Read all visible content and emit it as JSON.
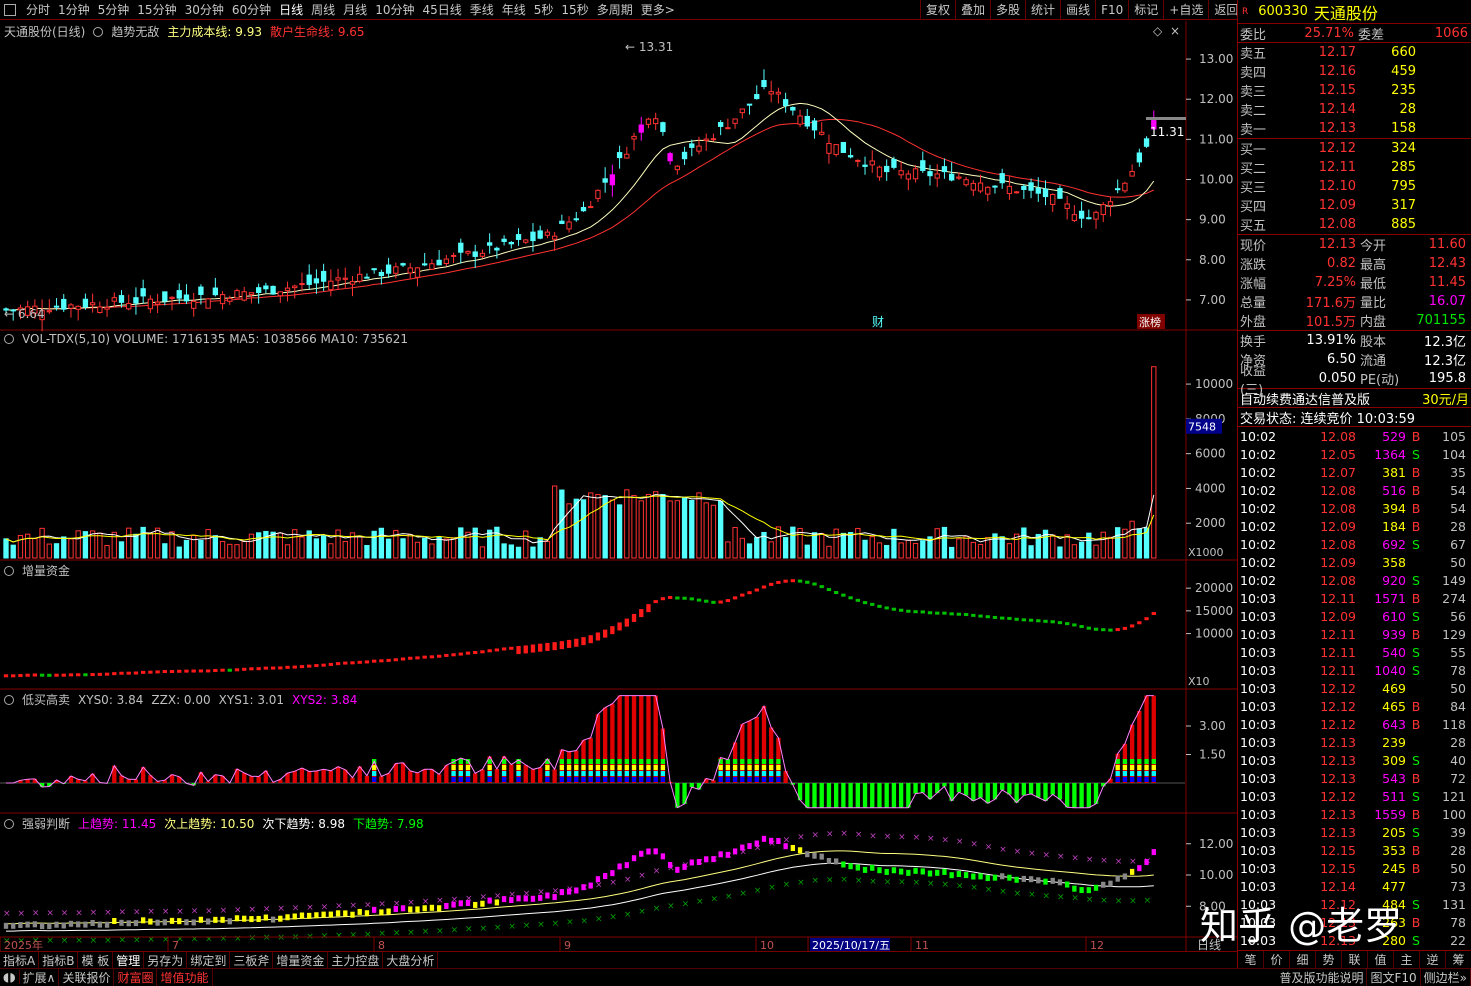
{
  "toolbar": {
    "periods": [
      "分时",
      "1分钟",
      "5分钟",
      "15分钟",
      "30分钟",
      "60分钟",
      "日线",
      "周线",
      "月线",
      "10分钟",
      "45日线",
      "季线",
      "年线",
      "5秒",
      "15秒",
      "多周期",
      "更多>"
    ],
    "active_period": "日线",
    "right_buttons": [
      "复权",
      "叠加",
      "多股",
      "统计",
      "画线",
      "F10",
      "标记",
      "+自选",
      "返回"
    ]
  },
  "main_panel": {
    "title": "天通股份(日线)",
    "indicator": "趋势无敌",
    "cost_label": "主力成本线: 9.93",
    "retail_label": "散户生命线: 9.65",
    "high_label": "13.31",
    "low_label": "6.64",
    "last_label": "11.31",
    "tag_cai": "财",
    "tag_zt": "涨榜",
    "y_ticks": [
      "13.00",
      "12.00",
      "11.00",
      "10.00",
      "9.00",
      "8.00",
      "7.00"
    ]
  },
  "vol_panel": {
    "title": "VOL-TDX(5,10) VOLUME: 1716135 MA5: 1038566 MA10: 735621",
    "y_ticks": [
      "10000",
      "8000",
      "6000",
      "4000",
      "2000"
    ],
    "unit": "X1000",
    "current_tag": "7548"
  },
  "zl_panel": {
    "title": "增量资金",
    "y_ticks": [
      "20000",
      "15000",
      "10000"
    ],
    "unit": "X10"
  },
  "dm_panel": {
    "title": "低买高卖",
    "xys0": "XYS0: 3.84",
    "zzx": "ZZX: 0.00",
    "xys1": "XYS1: 3.01",
    "xys2": "XYS2: 3.84",
    "y_ticks": [
      "3.00",
      "1.50"
    ]
  },
  "qr_panel": {
    "title": "强弱判断",
    "up": "上趋势: 11.45",
    "up2": "次上趋势: 10.50",
    "down2": "次下趋势: 8.98",
    "down": "下趋势: 7.98",
    "y_ticks": [
      "12.00",
      "10.00",
      "8.00"
    ]
  },
  "date_axis": [
    "2025年",
    "7",
    "8",
    "9",
    "10",
    "2025/10/17/五",
    "11",
    "12"
  ],
  "date_axis_right": "日线",
  "bottom_tabs1": [
    "指标A",
    "指标B",
    "模 板",
    "管理",
    "另存为",
    "绑定到",
    "三板斧",
    "增量资金",
    "主力控盘",
    "大盘分析"
  ],
  "bottom_tabs2": [
    "扩展∧",
    "关联报价",
    "财富圈",
    "增值功能"
  ],
  "bottom_right": [
    "普及版功能说明",
    "图文F10",
    "侧边栏»"
  ],
  "quote": {
    "code": "600330",
    "name": "天通股份",
    "weibi_label": "委比",
    "weibi": "25.71%",
    "weicha_label": "委差",
    "weicha": "1066",
    "asks": [
      {
        "label": "卖五",
        "price": "12.17",
        "vol": "660"
      },
      {
        "label": "卖四",
        "price": "12.16",
        "vol": "459"
      },
      {
        "label": "卖三",
        "price": "12.15",
        "vol": "235"
      },
      {
        "label": "卖二",
        "price": "12.14",
        "vol": "28"
      },
      {
        "label": "卖一",
        "price": "12.13",
        "vol": "158"
      }
    ],
    "bids": [
      {
        "label": "买一",
        "price": "12.12",
        "vol": "324"
      },
      {
        "label": "买二",
        "price": "12.11",
        "vol": "285"
      },
      {
        "label": "买三",
        "price": "12.10",
        "vol": "795"
      },
      {
        "label": "买四",
        "price": "12.09",
        "vol": "317"
      },
      {
        "label": "买五",
        "price": "12.08",
        "vol": "885"
      }
    ],
    "stats": [
      {
        "l1": "现价",
        "v1": "12.13",
        "l2": "今开",
        "v2": "11.60"
      },
      {
        "l1": "涨跌",
        "v1": "0.82",
        "l2": "最高",
        "v2": "12.43"
      },
      {
        "l1": "涨幅",
        "v1": "7.25%",
        "l2": "最低",
        "v2": "11.45"
      },
      {
        "l1": "总量",
        "v1": "171.6万",
        "l2": "量比",
        "v2": "16.07"
      },
      {
        "l1": "外盘",
        "v1": "101.5万",
        "l2": "内盘",
        "v2": "701155"
      }
    ],
    "stats2": [
      {
        "l1": "换手",
        "v1": "13.91%",
        "l2": "股本",
        "v2": "12.3亿"
      },
      {
        "l1": "净资",
        "v1": "6.50",
        "l2": "流通",
        "v2": "12.3亿"
      },
      {
        "l1": "收益(三)",
        "v1": "0.050",
        "l2": "PE(动)",
        "v2": "195.8"
      }
    ],
    "promo": "自动续费通达信普及版",
    "promo_price": "30元/月",
    "trade_status": "交易状态: 连续竞价 10:03:59",
    "ticks": [
      [
        "10:02",
        "12.08",
        "529",
        "B",
        "105"
      ],
      [
        "10:02",
        "12.05",
        "1364",
        "S",
        "104"
      ],
      [
        "10:02",
        "12.07",
        "381",
        "B",
        "35"
      ],
      [
        "10:02",
        "12.08",
        "516",
        "B",
        "54"
      ],
      [
        "10:02",
        "12.08",
        "394",
        "B",
        "54"
      ],
      [
        "10:02",
        "12.09",
        "184",
        "B",
        "28"
      ],
      [
        "10:02",
        "12.08",
        "692",
        "S",
        "67"
      ],
      [
        "10:02",
        "12.09",
        "358",
        "",
        "50"
      ],
      [
        "10:02",
        "12.08",
        "920",
        "S",
        "149"
      ],
      [
        "10:03",
        "12.11",
        "1571",
        "B",
        "274"
      ],
      [
        "10:03",
        "12.09",
        "610",
        "S",
        "56"
      ],
      [
        "10:03",
        "12.11",
        "939",
        "B",
        "129"
      ],
      [
        "10:03",
        "12.11",
        "540",
        "S",
        "55"
      ],
      [
        "10:03",
        "12.11",
        "1040",
        "S",
        "78"
      ],
      [
        "10:03",
        "12.12",
        "469",
        "",
        "50"
      ],
      [
        "10:03",
        "12.12",
        "465",
        "B",
        "84"
      ],
      [
        "10:03",
        "12.12",
        "643",
        "B",
        "118"
      ],
      [
        "10:03",
        "12.13",
        "239",
        "",
        "28"
      ],
      [
        "10:03",
        "12.13",
        "309",
        "S",
        "40"
      ],
      [
        "10:03",
        "12.13",
        "543",
        "B",
        "72"
      ],
      [
        "10:03",
        "12.12",
        "511",
        "S",
        "121"
      ],
      [
        "10:03",
        "12.13",
        "1559",
        "B",
        "100"
      ],
      [
        "10:03",
        "12.13",
        "205",
        "S",
        "39"
      ],
      [
        "10:03",
        "12.15",
        "353",
        "B",
        "28"
      ],
      [
        "10:03",
        "12.15",
        "245",
        "B",
        "50"
      ],
      [
        "10:03",
        "12.14",
        "477",
        "",
        "73"
      ],
      [
        "10:03",
        "12.12",
        "484",
        "S",
        "131"
      ],
      [
        "10:03",
        "12.13",
        "263",
        "B",
        "78"
      ],
      [
        "10:03",
        "12.13",
        "280",
        "S",
        "22"
      ]
    ],
    "bottom_tabs": [
      "笔",
      "价",
      "细",
      "势",
      "联",
      "值",
      "主",
      "逆",
      "筹"
    ]
  },
  "watermark": "知乎 @老罗",
  "colors": {
    "up": "#ff3232",
    "down": "#54ffff",
    "bg": "#000000",
    "grid": "#800000",
    "yellow": "#ffff00",
    "magenta": "#ff00ff"
  }
}
